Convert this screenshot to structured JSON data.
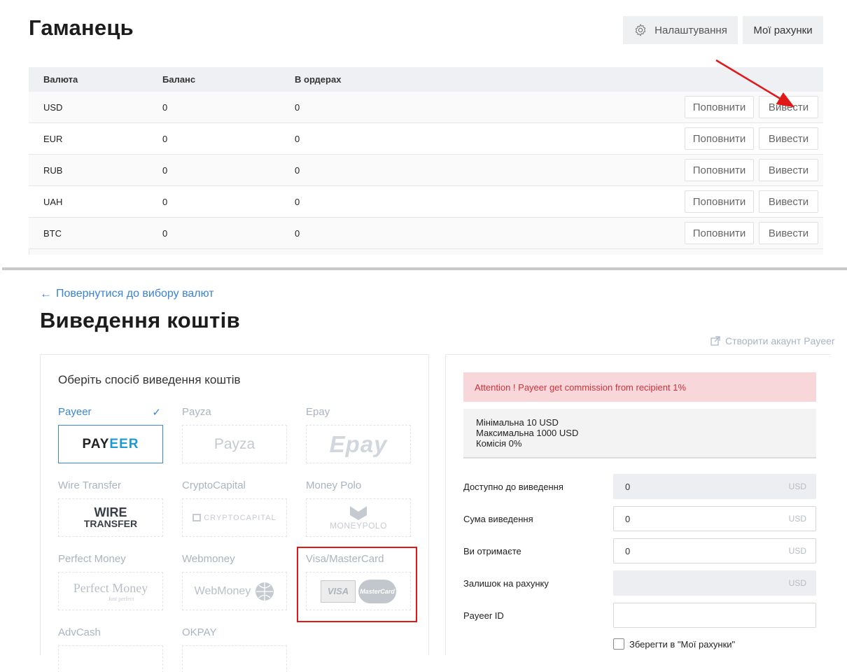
{
  "wallet": {
    "title": "Гаманець",
    "settings_label": "Налаштування",
    "accounts_label": "Мої рахунки",
    "columns": [
      "Валюта",
      "Баланс",
      "В ордерах"
    ],
    "rows": [
      {
        "currency": "USD",
        "balance": "0",
        "orders": "0",
        "deposit": "Поповнити",
        "withdraw": "Вивести"
      },
      {
        "currency": "EUR",
        "balance": "0",
        "orders": "0",
        "deposit": "Поповнити",
        "withdraw": "Вивести"
      },
      {
        "currency": "RUB",
        "balance": "0",
        "orders": "0",
        "deposit": "Поповнити",
        "withdraw": "Вивести"
      },
      {
        "currency": "UAH",
        "balance": "0",
        "orders": "0",
        "deposit": "Поповнити",
        "withdraw": "Вивести"
      },
      {
        "currency": "BTC",
        "balance": "0",
        "orders": "0",
        "deposit": "Поповнити",
        "withdraw": "Вивести"
      }
    ]
  },
  "withdrawal": {
    "back_link": "Повернутися до вибору валют",
    "title": "Виведення коштів",
    "create_account_link": "Створити акаунт Payeer",
    "methods_heading": "Оберіть спосіб виведення коштів",
    "methods": [
      {
        "name": "Payeer",
        "logo_text_a": "PAY",
        "logo_text_b": "EER",
        "selected": true
      },
      {
        "name": "Payza",
        "logo_text": "Payza"
      },
      {
        "name": "Epay",
        "logo_text": "Epay"
      },
      {
        "name": "Wire Transfer",
        "logo_text_a": "WIRE",
        "logo_text_b": "TRANSFER"
      },
      {
        "name": "CryptoCapital",
        "logo_text": "CRYPTOCAPITAL"
      },
      {
        "name": "Money Polo",
        "logo_text": "MONEYPOLO"
      },
      {
        "name": "Perfect Money",
        "logo_text": "Perfect Money",
        "logo_sub": "Just perfect"
      },
      {
        "name": "Webmoney",
        "logo_text": "WebMoney"
      },
      {
        "name": "Visa/MasterCard",
        "logo_text_a": "VISA",
        "logo_text_b": "MasterCard"
      },
      {
        "name": "AdvCash"
      },
      {
        "name": "OKPAY"
      }
    ],
    "alert": "Attention ! Payeer get commission from recipient 1%",
    "limits": {
      "min": "Мінімальна 10 USD",
      "max": "Максимальна 1000 USD",
      "fee": "Комісія 0%"
    },
    "fields": [
      {
        "label": "Доступно до виведення",
        "value": "0",
        "unit": "USD",
        "readonly": true
      },
      {
        "label": "Сума виведення",
        "value": "0",
        "unit": "USD",
        "readonly": false
      },
      {
        "label": "Ви отримаєте",
        "value": "0",
        "unit": "USD",
        "readonly": false
      },
      {
        "label": "Залишок на рахунку",
        "value": "",
        "unit": "USD",
        "readonly": true
      },
      {
        "label": "Payeer ID",
        "value": "",
        "unit": "",
        "readonly": false
      }
    ],
    "save_checkbox_label": "Зберегти в \"Мої рахунки\""
  },
  "colors": {
    "accent_blue": "#3a86d4",
    "annotation_red": "#e01818",
    "alert_bg": "#f8d7da",
    "alert_text": "#d0303a"
  }
}
